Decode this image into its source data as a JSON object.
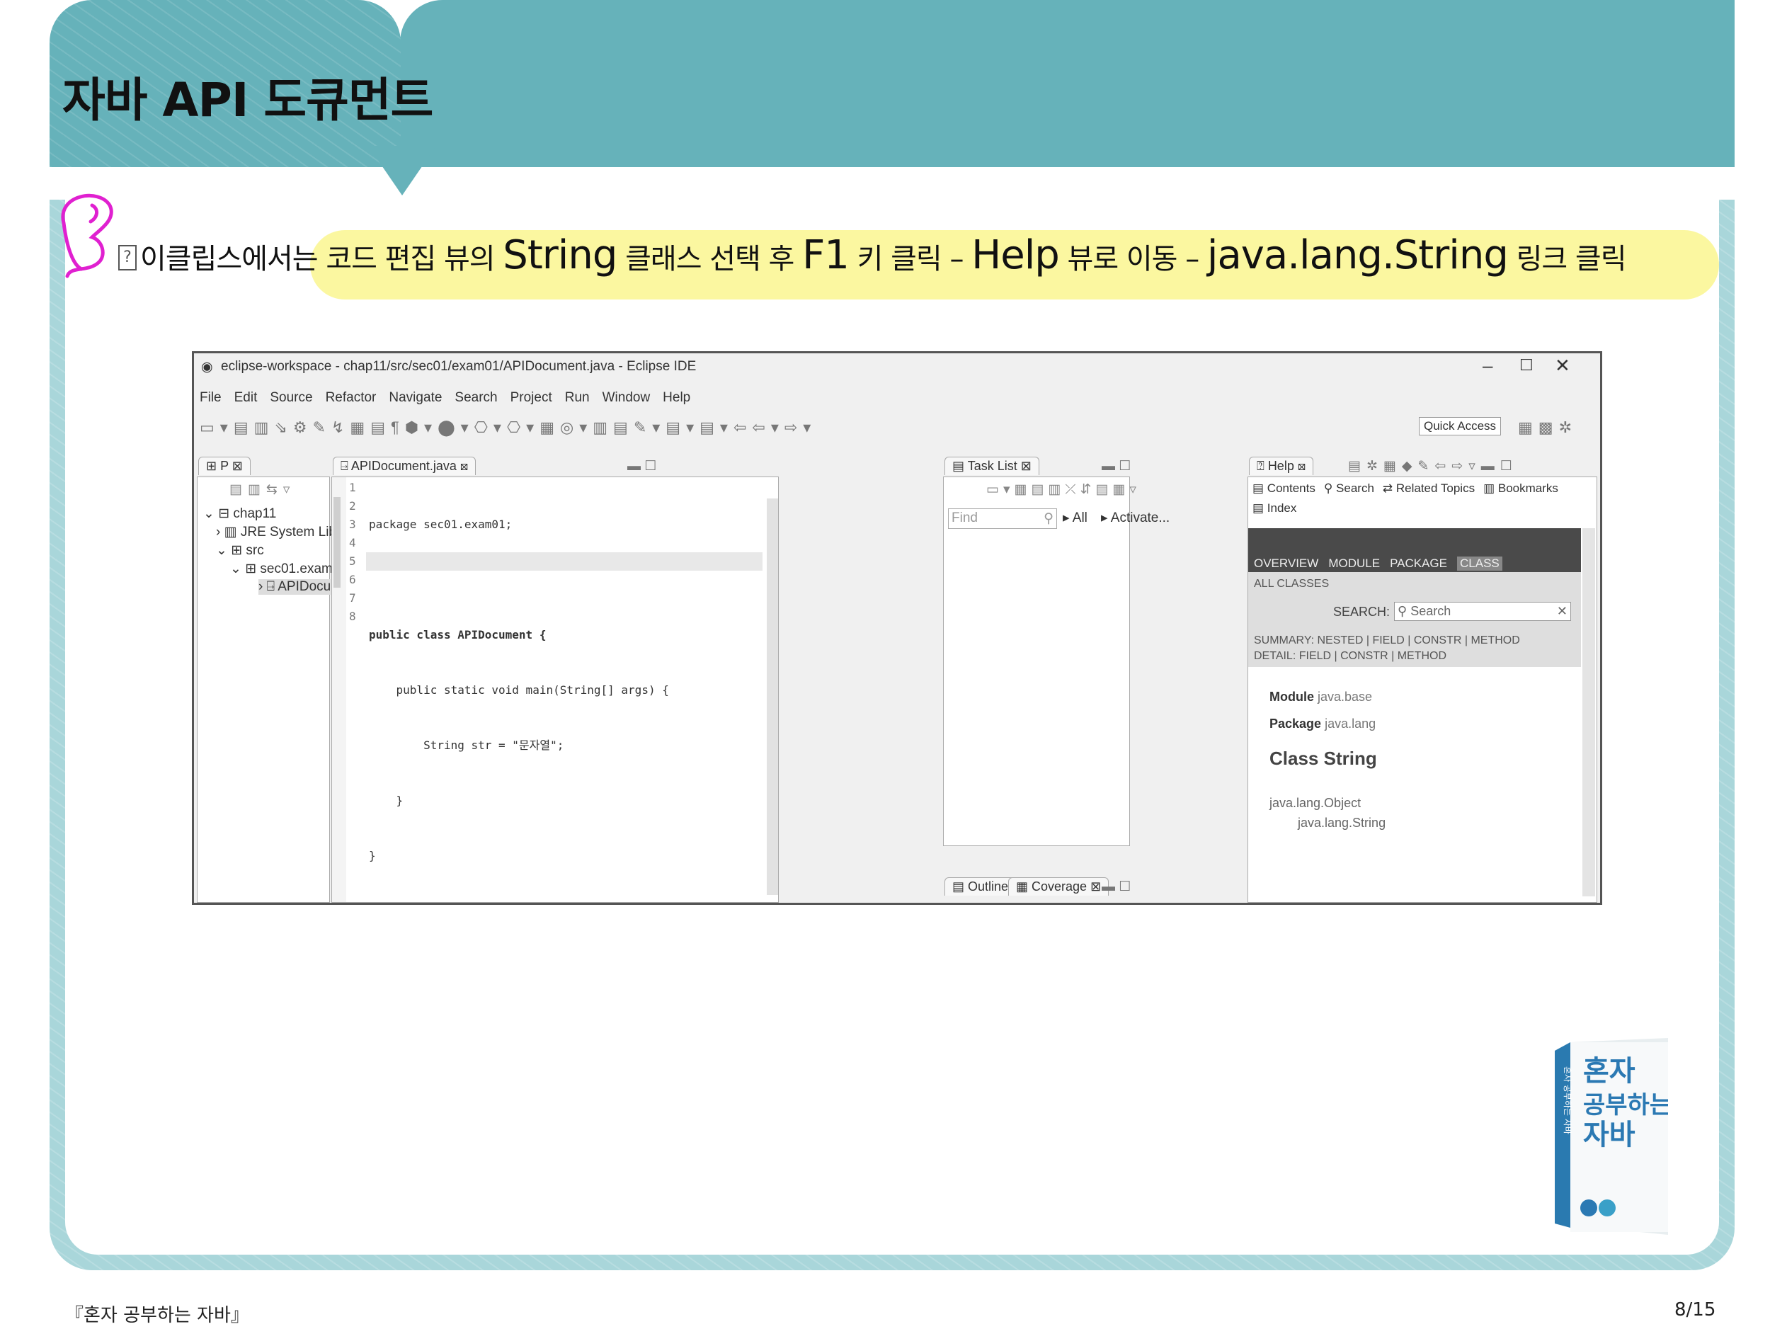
{
  "slide": {
    "title": "자바 API 도큐먼트",
    "instruction": {
      "part1": "이클립스에서는 코드 편집 뷰의 ",
      "string": "String",
      "part2": " 클래스 선택 후 ",
      "f1": "F1",
      "part3": " 키 클릭 – ",
      "help": "Help",
      "part4": " 뷰로 이동 – ",
      "link": "java.lang.String",
      "part5": " 링크 클릭"
    },
    "footer_left": "『혼자 공부하는 자바』",
    "footer_right": "8/15",
    "highlight_color": "#fbf7a0",
    "header_color": "#66b2ba"
  },
  "eclipse": {
    "window_title": "eclipse-workspace - chap11/src/sec01/exam01/APIDocument.java - Eclipse IDE",
    "menu": [
      "File",
      "Edit",
      "Source",
      "Refactor",
      "Navigate",
      "Search",
      "Project",
      "Run",
      "Window",
      "Help"
    ],
    "quick_access": "Quick Access",
    "left_tab": "P",
    "tree": [
      "chap11",
      "JRE System Lib",
      "src",
      "sec01.exam",
      "APIDocu"
    ],
    "editor_tab": "APIDocument.java",
    "line_numbers": [
      "1",
      "2",
      "3",
      "4",
      "5",
      "6",
      "7",
      "8"
    ],
    "code": [
      "package sec01.exam01;",
      "",
      "public class APIDocument {",
      "    public static void main(String[] args) {",
      "        String str = \"문자열\";",
      "    }",
      "}",
      ""
    ],
    "tasklist_tab": "Task List",
    "find_placeholder": "Find",
    "tasklist_all": "All",
    "tasklist_activate": "Activate...",
    "outline_tab": "Outline",
    "coverage_tab": "Coverage",
    "help_tab": "Help",
    "help_links": [
      "Contents",
      "Search",
      "Related Topics",
      "Bookmarks"
    ],
    "help_index": "Index",
    "help_nav": [
      "OVERVIEW",
      "MODULE",
      "PACKAGE",
      "CLASS"
    ],
    "all_classes": "ALL CLASSES",
    "search_label": "SEARCH:",
    "search_placeholder": "Search",
    "summary": "SUMMARY: NESTED | FIELD | CONSTR | METHOD",
    "detail": "DETAIL: FIELD | CONSTR | METHOD",
    "module_label": "Module",
    "module_value": "java.base",
    "package_label": "Package",
    "package_value": "java.lang",
    "class_title": "Class String",
    "hierarchy": [
      "java.lang.Object",
      "java.lang.String"
    ]
  },
  "book": {
    "title_chars": [
      "혼자",
      "공부하는",
      "자바"
    ],
    "spine": "혼자 공부하는 자바"
  }
}
